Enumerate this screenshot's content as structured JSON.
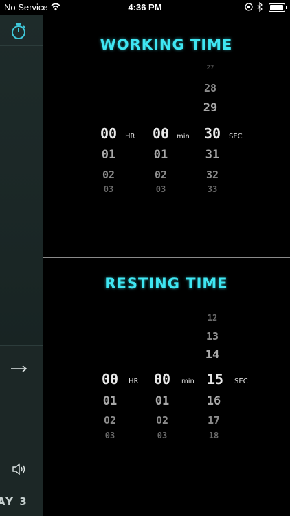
{
  "status_bar": {
    "carrier": "No Service",
    "time": "4:36 PM"
  },
  "working": {
    "title": "WORKING TIME",
    "hours": {
      "above": [],
      "selected": "00",
      "below": [
        "01",
        "02",
        "03"
      ]
    },
    "minutes": {
      "above": [],
      "selected": "00",
      "below": [
        "01",
        "02",
        "03"
      ]
    },
    "seconds": {
      "above": [
        "27",
        "28",
        "29"
      ],
      "selected": "30",
      "below": [
        "31",
        "32",
        "33"
      ]
    },
    "units": {
      "hours": "HR",
      "minutes": "min",
      "seconds": "SEC"
    }
  },
  "resting": {
    "title": "RESTING TIME",
    "hours": {
      "above": [],
      "selected": "00",
      "below": [
        "01",
        "02",
        "03"
      ]
    },
    "minutes": {
      "above": [],
      "selected": "00",
      "below": [
        "01",
        "02",
        "03"
      ]
    },
    "seconds": {
      "above": [
        "12",
        "13",
        "14"
      ],
      "selected": "15",
      "below": [
        "16",
        "17",
        "18"
      ]
    },
    "units": {
      "hours": "HR",
      "minutes": "min",
      "seconds": "SEC"
    }
  },
  "sidebar": {
    "bottom_label": "AY 3",
    "icons": [
      "stopwatch-icon",
      "arrow-right-icon",
      "speaker-icon"
    ]
  },
  "colors": {
    "accent": "#3fe6f2",
    "background": "#000000",
    "sidebar": "#1b2827"
  }
}
